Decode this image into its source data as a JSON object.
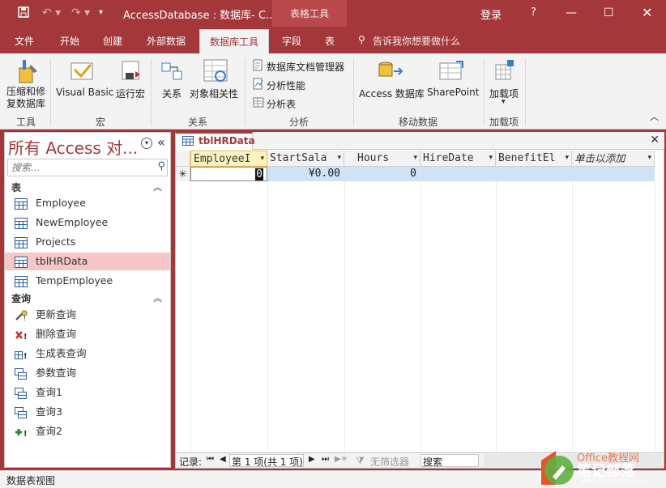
{
  "titlebar": {
    "title": "AccessDatabase : 数据库- C...",
    "context_tab": "表格工具",
    "login": "登录",
    "help": "?",
    "qat_customize": "▾"
  },
  "tabs": [
    "文件",
    "开始",
    "创建",
    "外部数据",
    "数据库工具",
    "字段",
    "表"
  ],
  "tell_me": "告诉我你想要做什么",
  "ribbon": {
    "groups": [
      {
        "label": "工具",
        "buttons": [
          "压缩和修\n复数据库"
        ]
      },
      {
        "label": "宏",
        "buttons": [
          "Visual Basic",
          "运行宏"
        ]
      },
      {
        "label": "关系",
        "buttons": [
          "关系",
          "对象相关性"
        ]
      },
      {
        "label": "分析",
        "buttons": [
          "数据库文档管理器",
          "分析性能",
          "分析表"
        ]
      },
      {
        "label": "移动数据",
        "buttons": [
          "Access 数据库",
          "SharePoint"
        ]
      },
      {
        "label": "加载项",
        "buttons": [
          "加载项"
        ]
      }
    ]
  },
  "nav": {
    "title": "所有 Access 对...",
    "search_placeholder": "搜索...",
    "sections": [
      {
        "name": "表",
        "items": [
          "Employee",
          "NewEmployee",
          "Projects",
          "tblHRData",
          "TempEmployee"
        ],
        "selected": "tblHRData"
      },
      {
        "name": "查询",
        "items": [
          "更新查询",
          "删除查询",
          "生成表查询",
          "参数查询",
          "查询1",
          "查询3",
          "查询2"
        ]
      }
    ]
  },
  "document": {
    "tab": "tblHRData",
    "columns": [
      "EmployeeI",
      "StartSala",
      "Hours",
      "HireDate",
      "BenefitEl",
      "单击以添加"
    ],
    "new_row": {
      "marker": "✳",
      "EmployeeI": "0",
      "StartSala": "¥0.00",
      "Hours": "0",
      "HireDate": "",
      "BenefitEl": ""
    }
  },
  "record_bar": {
    "label": "记录:",
    "position": "第 1 项(共 1 项)",
    "filter": "无筛选器",
    "search": "搜索"
  },
  "status": "数据表视图",
  "watermark": {
    "line1": "Office教程网",
    "line2": "笔记部落",
    "line3": "www.notetribe.com"
  },
  "colors": {
    "accent": "#a4373a",
    "selected_nav": "#f7c6c7",
    "selected_row": "#cfe3f7"
  }
}
